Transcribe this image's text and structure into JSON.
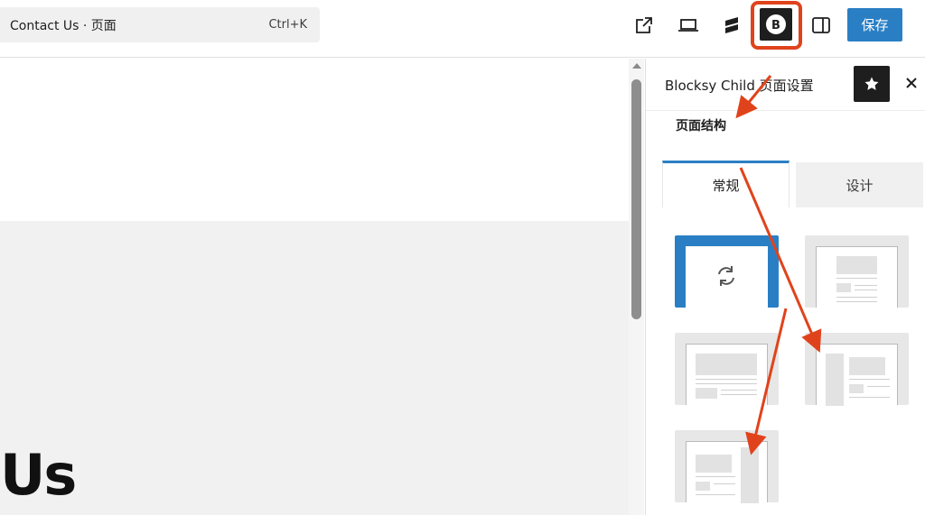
{
  "topbar": {
    "command_title": "Contact Us · 页面",
    "command_shortcut": "Ctrl+K",
    "save_label": "保存",
    "accent_color": "#2a7fc4",
    "highlight_color": "#e0431c"
  },
  "canvas": {
    "title_fragment": "Us"
  },
  "sidebar": {
    "title": "Blocksy Child 页面设置",
    "section_title": "页面结构",
    "tabs": [
      {
        "label": "常规",
        "active": true
      },
      {
        "label": "设计",
        "active": false
      }
    ],
    "layout_options": [
      {
        "icon": "reset-icon",
        "selected": true
      },
      {
        "icon": "layout-normal-icon",
        "selected": false
      },
      {
        "icon": "layout-full-width-icon",
        "selected": false
      },
      {
        "icon": "layout-left-sidebar-icon",
        "selected": false
      },
      {
        "icon": "layout-right-sidebar-icon",
        "selected": false
      }
    ]
  },
  "icons": {
    "external": "external-link-icon",
    "view": "desktop-view-icon",
    "brand": "stackable-icon",
    "blocksy": "blocksy-icon",
    "panel": "sidebar-toggle-icon",
    "star": "star-icon",
    "close": "close-icon"
  }
}
